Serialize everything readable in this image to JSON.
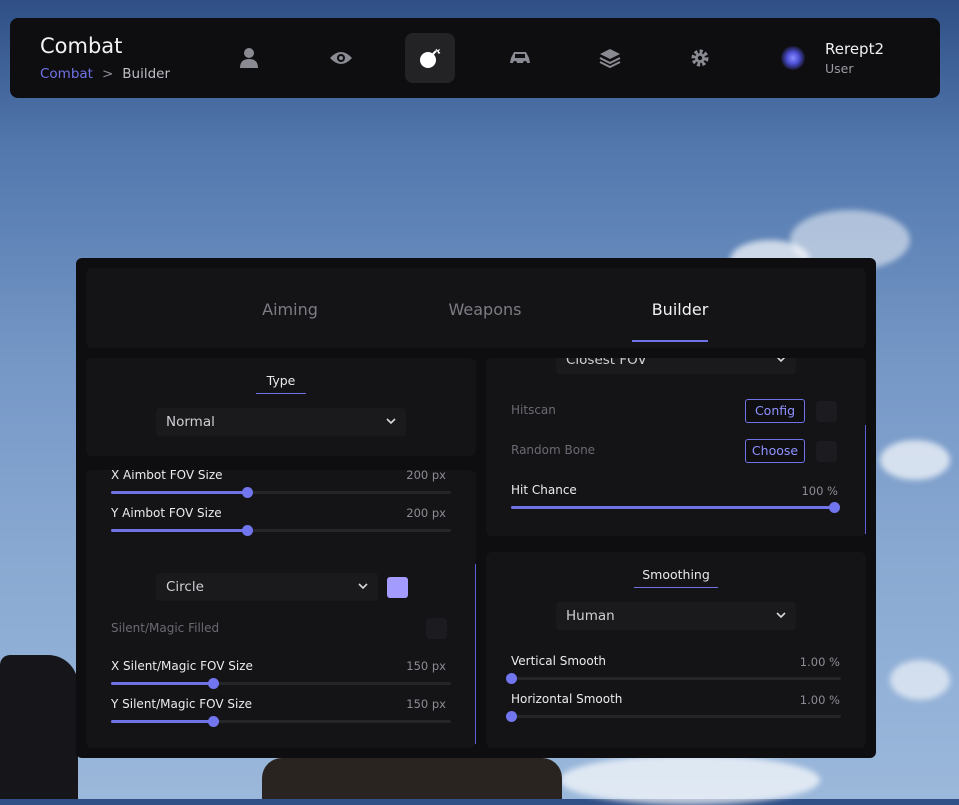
{
  "header": {
    "title": "Combat",
    "breadcrumb": {
      "root": "Combat",
      "separator": ">",
      "current": "Builder"
    },
    "nav_icons": [
      "user-icon",
      "eye-icon",
      "bomb-icon",
      "car-icon",
      "layers-icon",
      "gear-icon"
    ],
    "active_nav": "bomb-icon",
    "user": {
      "name": "Rerept2",
      "role": "User"
    }
  },
  "tabs": [
    "Aiming",
    "Weapons",
    "Builder"
  ],
  "active_tab": "Builder",
  "type_card": {
    "title": "Type",
    "select_value": "Normal"
  },
  "fov_card": {
    "sliders": [
      {
        "label": "X Aimbot FOV Size",
        "value_text": "200 px",
        "fraction": 0.4
      },
      {
        "label": "Y Aimbot FOV Size",
        "value_text": "200 px",
        "fraction": 0.4
      }
    ],
    "shape_select": "Circle",
    "shape_color": "#a49bff",
    "silent_filled_label": "Silent/Magic Filled",
    "silent_filled_checked": false,
    "silent_sliders": [
      {
        "label": "X Silent/Magic FOV Size",
        "value_text": "150 px",
        "fraction": 0.3
      },
      {
        "label": "Y Silent/Magic FOV Size",
        "value_text": "150 px",
        "fraction": 0.3
      }
    ]
  },
  "target_card": {
    "select_value": "Closest FOV",
    "hitscan_label": "Hitscan",
    "hitscan_button": "Config",
    "random_bone_label": "Random Bone",
    "random_bone_button": "Choose",
    "hit_chance": {
      "label": "Hit Chance",
      "value_text": "100 %",
      "fraction": 1.0
    }
  },
  "smoothing_card": {
    "title": "Smoothing",
    "select_value": "Human",
    "sliders": [
      {
        "label": "Vertical Smooth",
        "value_text": "1.00 %",
        "fraction": 0.0
      },
      {
        "label": "Horizontal Smooth",
        "value_text": "1.00 %",
        "fraction": 0.0
      }
    ]
  },
  "colors": {
    "accent": "#6f73e6",
    "panel": "#0e0e10",
    "card": "#141417"
  }
}
